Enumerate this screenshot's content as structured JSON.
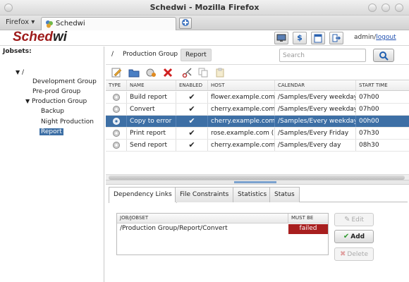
{
  "window": {
    "title": "Schedwi - Mozilla Firefox",
    "browser_menu": "Firefox ▾",
    "tab_title": "Schedwi",
    "new_tab_glyph": "+"
  },
  "app": {
    "logo_part1": "Sched",
    "logo_part2": "wi",
    "header_icons": [
      "monitor-icon",
      "dollar-icon",
      "calendar-icon",
      "exit-icon"
    ],
    "user": "admin/",
    "logout": "logout"
  },
  "sidebar": {
    "title": "Jobsets:",
    "root": "/",
    "nodes": [
      {
        "label": "Development Group"
      },
      {
        "label": "Pre-prod Group"
      },
      {
        "label": "Production Group"
      },
      {
        "label": "Backup"
      },
      {
        "label": "Night Production"
      },
      {
        "label": "Report"
      }
    ],
    "triangle": "▼"
  },
  "path": {
    "root": "/",
    "parent": "Production Group",
    "current": "Report",
    "search_placeholder": "Search"
  },
  "toolbar": {
    "icons": [
      "edit-icon",
      "open-folder-icon",
      "add-job-icon",
      "delete-icon",
      "cut-icon",
      "copy-icon",
      "paste-icon"
    ]
  },
  "jobs": {
    "columns": [
      "TYPE",
      "NAME",
      "ENABLED",
      "HOST",
      "CALENDAR",
      "START TIME"
    ],
    "rows": [
      {
        "name": "Build report",
        "enabled": "✔",
        "host": "flower.example.com",
        "calendar": "/Samples/Every weekday",
        "start": "07h00"
      },
      {
        "name": "Convert",
        "enabled": "✔",
        "host": "cherry.example.com",
        "calendar": "/Samples/Every weekday",
        "start": "07h00"
      },
      {
        "name": "Copy to error",
        "enabled": "✔",
        "host": "cherry.example.com",
        "calendar": "/Samples/Every weekday",
        "start": "00h00"
      },
      {
        "name": "Print report",
        "enabled": "✔",
        "host": "rose.example.com (",
        "calendar": "/Samples/Every Friday",
        "start": "07h30"
      },
      {
        "name": "Send report",
        "enabled": "✔",
        "host": "cherry.example.com",
        "calendar": "/Samples/Every day",
        "start": "08h30"
      }
    ],
    "selected_index": 2
  },
  "bottom": {
    "tabs": [
      "Dependency Links",
      "File Constraints",
      "Statistics",
      "Status"
    ],
    "active_tab": 0,
    "dep_columns": [
      "JOB/JOBSET",
      "MUST BE"
    ],
    "dep_rows": [
      {
        "job": "/Production Group/Report/Convert",
        "must_be": "failed"
      }
    ],
    "buttons": {
      "edit": "Edit",
      "add": "Add",
      "delete": "Delete"
    }
  },
  "colors": {
    "selection": "#3d6fa5",
    "failed": "#a81f1f",
    "logo_red": "#9e1b1b"
  }
}
